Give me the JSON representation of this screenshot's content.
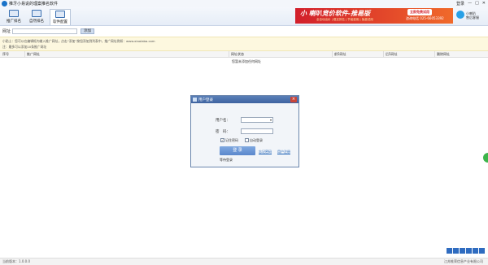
{
  "window": {
    "title": "推牙小易说的理案推名软件",
    "controls": [
      "登录",
      "—",
      "□",
      "✕"
    ]
  },
  "tabs": [
    {
      "label": "推广排名",
      "active": false
    },
    {
      "label": "自然排名",
      "active": false
    },
    {
      "label": "软件配置",
      "active": true
    }
  ],
  "ad": {
    "title": "小 喇叭竞价软件-推易版",
    "subtitle": "全自动出价 | 稳定排名 | 节省费用 | 免费试用",
    "button": "立即免费试用",
    "phone": "咨询电话 025-66053392"
  },
  "support": {
    "line1": "小喇叭",
    "line2": "售后客服"
  },
  "url_row": {
    "label": "网址",
    "value": "",
    "button": "添加"
  },
  "tips": {
    "line1": "小贴士：您可以在编辑框内输入推广网址，点击“添加”按钮添加到列表中，推广网址例如：www.xiaolaba.com",
    "line2": "注：最多可以添加10条推广网址"
  },
  "table": {
    "headers": [
      "序号",
      "推广网址",
      "网址状态",
      "前5网址",
      "后5网址",
      "删除网址"
    ],
    "empty_text": "您暂未添加任何网址"
  },
  "dialog": {
    "title": "用户登录",
    "username_label": "用户名：",
    "username_value": "",
    "password_label": "密　码：",
    "password_value": "",
    "remember_label": "记住密码",
    "remember_checked": true,
    "autologin_label": "自动登录",
    "autologin_checked": false,
    "login_button": "登 录",
    "forgot_link": "忘记密码",
    "register_link": "用户注册",
    "status": "等待登录"
  },
  "statusbar": {
    "version": "当前版本：1.0.0.0",
    "company": "江苏推荣信息产业有限公司"
  }
}
